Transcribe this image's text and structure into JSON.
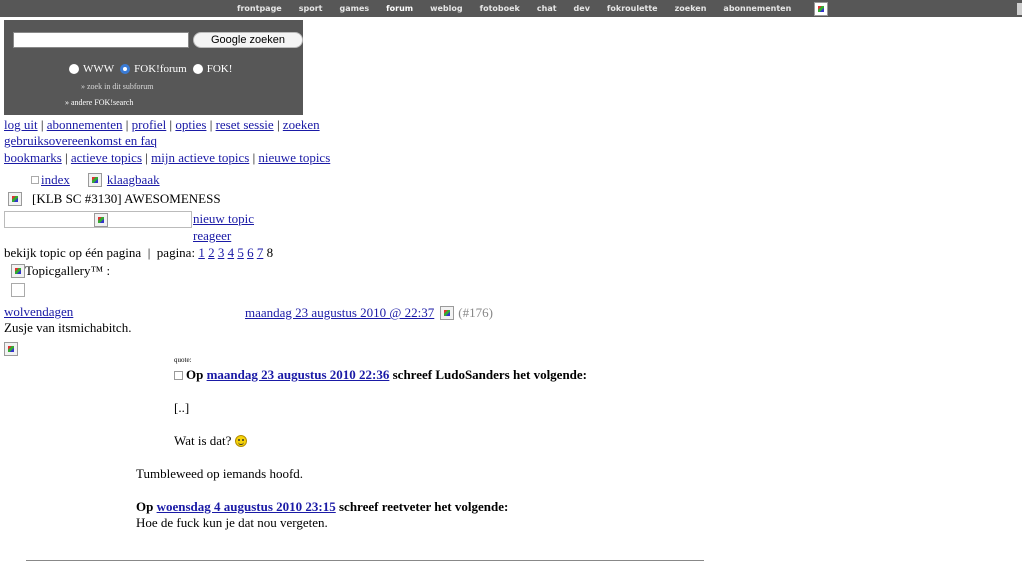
{
  "topnav": {
    "items": [
      "frontpage",
      "sport",
      "games",
      "forum",
      "weblog",
      "fotoboek",
      "chat",
      "dev",
      "fokroulette",
      "zoeken",
      "abonnementen"
    ],
    "active": "forum"
  },
  "search": {
    "button_label": "Google zoeken",
    "options": [
      "WWW",
      "FOK!forum",
      "FOK!"
    ],
    "selected": "FOK!forum",
    "link_subforum": "» zoek in dit subforum",
    "link_other": "» andere FOK!search"
  },
  "userlinks": {
    "row1": [
      "log uit",
      "abonnementen",
      "profiel",
      "opties",
      "reset sessie",
      "zoeken"
    ],
    "row2": "gebruiksovereenkomst en faq",
    "row3": [
      "bookmarks",
      "actieve topics",
      "mijn actieve topics",
      "nieuwe topics"
    ]
  },
  "breadcrumb": {
    "index": "index",
    "forum": "klaagbaak"
  },
  "topic": {
    "title": "[KLB SC #3130] AWESOMENESS",
    "new_topic": "nieuw topic",
    "reply": "reageer",
    "one_page": "bekijk topic op één pagina",
    "pages_label": "pagina:",
    "pages": [
      "1",
      "2",
      "3",
      "4",
      "5",
      "6",
      "7"
    ],
    "current_page": "8",
    "gallery": "Topicgallery™ :"
  },
  "post": {
    "author": "wolvendagen",
    "subtitle": "Zusje van itsmichabitch.",
    "date": "maandag 23 augustus 2010 @ 22:37",
    "number": "(#176)",
    "quote_label": "quote:",
    "quote1_prefix": "Op",
    "quote1_date": "maandag 23 augustus 2010 22:36",
    "quote1_suffix": "schreef LudoSanders het volgende:",
    "quote1_inner": "[..]",
    "quote1_text": "Wat is dat?",
    "reply_text": "Tumbleweed op iemands hoofd.",
    "quote2_prefix": "Op",
    "quote2_date": "woensdag 4 augustus 2010 23:15",
    "quote2_suffix": "schreef reetveter het volgende:",
    "quote2_text": "Hoe de fuck kun je dat nou vergeten."
  }
}
